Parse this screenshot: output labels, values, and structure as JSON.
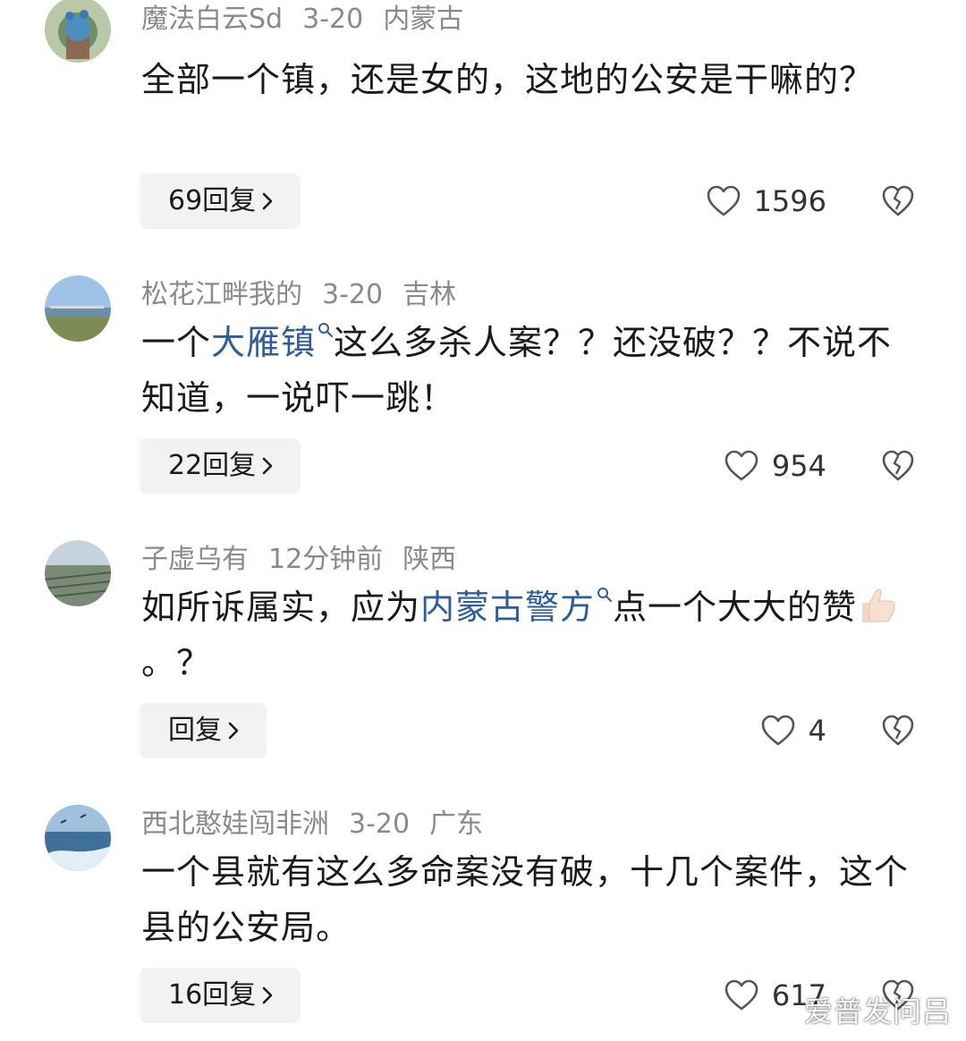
{
  "comments": [
    {
      "username": "魔法白云Sd",
      "time": "3-20",
      "location": "内蒙古",
      "text_before": "全部一个镇，还是女的，这地的公安是干嘛的？",
      "link": "",
      "text_after": "",
      "reply_label": "69回复",
      "likes": "1596"
    },
    {
      "username": "松花江畔我的",
      "time": "3-20",
      "location": "吉林",
      "text_before": "一个",
      "link": "大雁镇",
      "text_after": "这么多杀人案？？还没破？？不说不知道，一说吓一跳！",
      "reply_label": "22回复",
      "likes": "954"
    },
    {
      "username": "子虚乌有",
      "time": "12分钟前",
      "location": "陕西",
      "text_before": "如所诉属实，应为",
      "link": "内蒙古警方",
      "text_after": "点一个大大的赞",
      "text_tail": "。？",
      "reply_label": "回复",
      "likes": "4"
    },
    {
      "username": "西北憨娃闯非洲",
      "time": "3-20",
      "location": "广东",
      "text_before": "一个县就有这么多命案没有破，十几个案件，这个县的公安局。",
      "link": "",
      "text_after": "",
      "reply_label": "16回复",
      "likes": "617"
    }
  ],
  "watermark": "爱普发问吕",
  "icons": {
    "like": "heart-outline-icon",
    "dislike": "broken-heart-icon",
    "reply_chevron": "chevron-right-icon",
    "link_search": "search-icon",
    "emoji": "thumbs-up-emoji"
  },
  "colors": {
    "link": "#2f5d9b",
    "meta": "#8a8a8a",
    "reply_bg": "#f1f2f3"
  }
}
